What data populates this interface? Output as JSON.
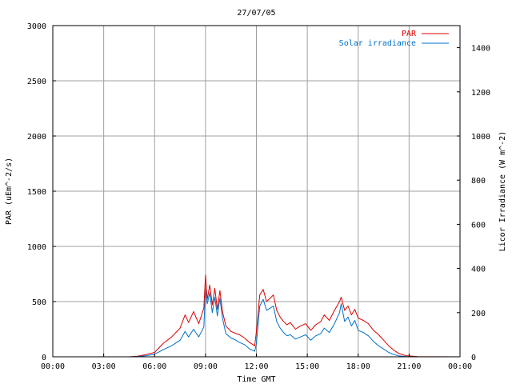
{
  "chart_data": {
    "type": "line",
    "title": "27/07/05",
    "xlabel": "Time GMT",
    "ylabel_left": "PAR (uEm^-2/s)",
    "ylabel_right": "Licor Irradiance (W m^-2)",
    "x_ticks": [
      "00:00",
      "03:00",
      "06:00",
      "09:00",
      "12:00",
      "15:00",
      "18:00",
      "21:00",
      "00:00"
    ],
    "xlim_hours": [
      0,
      24
    ],
    "ylim_left": [
      0,
      3000
    ],
    "ylim_right": [
      0,
      1500
    ],
    "yticks_left": [
      0,
      500,
      1000,
      1500,
      2000,
      2500,
      3000
    ],
    "yticks_right": [
      0,
      200,
      400,
      600,
      800,
      1000,
      1200,
      1400
    ],
    "grid": true,
    "legend_position": "top-right",
    "series": [
      {
        "name": "PAR",
        "axis": "left",
        "color": "#dd0000",
        "x_hours": [
          0,
          4.5,
          5.0,
          5.5,
          6.0,
          6.5,
          7.0,
          7.5,
          7.8,
          8.0,
          8.3,
          8.6,
          8.9,
          9.0,
          9.1,
          9.25,
          9.4,
          9.55,
          9.7,
          9.85,
          10.0,
          10.2,
          10.5,
          10.8,
          11.0,
          11.3,
          11.6,
          11.9,
          12.0,
          12.2,
          12.4,
          12.6,
          12.8,
          13.0,
          13.2,
          13.4,
          13.6,
          13.8,
          14.0,
          14.3,
          14.6,
          14.9,
          15.2,
          15.5,
          15.8,
          16.0,
          16.3,
          16.6,
          16.9,
          17.0,
          17.2,
          17.4,
          17.6,
          17.8,
          18.0,
          18.3,
          18.6,
          18.9,
          19.2,
          19.5,
          19.8,
          20.1,
          20.4,
          20.8,
          21.5,
          24
        ],
        "values": [
          0,
          0,
          5,
          20,
          40,
          120,
          180,
          260,
          380,
          310,
          410,
          300,
          440,
          740,
          520,
          650,
          470,
          620,
          430,
          600,
          410,
          280,
          230,
          210,
          200,
          170,
          130,
          100,
          230,
          560,
          610,
          500,
          530,
          560,
          420,
          360,
          320,
          290,
          310,
          250,
          280,
          300,
          240,
          290,
          320,
          380,
          330,
          420,
          500,
          540,
          420,
          460,
          380,
          430,
          350,
          330,
          300,
          240,
          200,
          150,
          100,
          60,
          30,
          10,
          2,
          0
        ]
      },
      {
        "name": "Solar irradiance",
        "axis": "right",
        "color": "#0070c8",
        "x_hours": [
          0,
          4.5,
          5.0,
          5.5,
          6.0,
          6.5,
          7.0,
          7.5,
          7.8,
          8.0,
          8.3,
          8.6,
          8.9,
          9.0,
          9.1,
          9.25,
          9.4,
          9.55,
          9.7,
          9.85,
          10.0,
          10.2,
          10.5,
          10.8,
          11.0,
          11.3,
          11.6,
          11.9,
          12.0,
          12.2,
          12.4,
          12.6,
          12.8,
          13.0,
          13.2,
          13.4,
          13.6,
          13.8,
          14.0,
          14.3,
          14.6,
          14.9,
          15.2,
          15.5,
          15.8,
          16.0,
          16.3,
          16.6,
          16.9,
          17.0,
          17.2,
          17.4,
          17.6,
          17.8,
          18.0,
          18.3,
          18.6,
          18.9,
          19.2,
          19.5,
          19.8,
          20.1,
          20.4,
          20.8,
          21.5,
          24
        ],
        "values": [
          0,
          0,
          1,
          5,
          12,
          32,
          50,
          75,
          115,
          90,
          125,
          90,
          135,
          305,
          240,
          290,
          200,
          270,
          185,
          265,
          175,
          105,
          85,
          75,
          65,
          55,
          35,
          25,
          60,
          230,
          260,
          210,
          220,
          230,
          160,
          130,
          110,
          95,
          100,
          80,
          90,
          100,
          75,
          95,
          105,
          130,
          110,
          150,
          200,
          240,
          160,
          180,
          140,
          165,
          120,
          110,
          95,
          70,
          50,
          35,
          20,
          10,
          4,
          1,
          0,
          0
        ]
      }
    ]
  }
}
